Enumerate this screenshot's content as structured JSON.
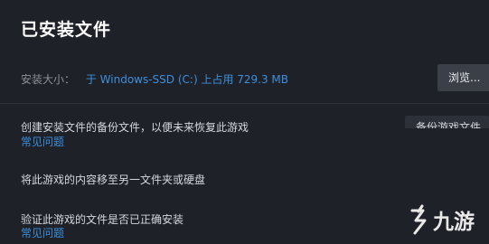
{
  "page": {
    "title": "已安装文件"
  },
  "install_size": {
    "label": "安装大小：",
    "value": "于 Windows-SSD (C:) 上占用 729.3 MB"
  },
  "buttons": {
    "browse_label": "浏览...",
    "backup_label": "备份游戏文件"
  },
  "items": [
    {
      "text": "创建安装文件的备份文件，以便未来恢复此游戏",
      "link": "常见问题"
    },
    {
      "text": "将此游戏的内容移至另一文件夹或硬盘"
    },
    {
      "text": "验证此游戏的文件是否已正确安装",
      "link": "常见问题"
    }
  ],
  "watermark": {
    "text": "九游",
    "color": "#ffffff"
  },
  "colors": {
    "background": "#1e2128",
    "link": "#3c8fdc",
    "button": "#3b3f47"
  }
}
